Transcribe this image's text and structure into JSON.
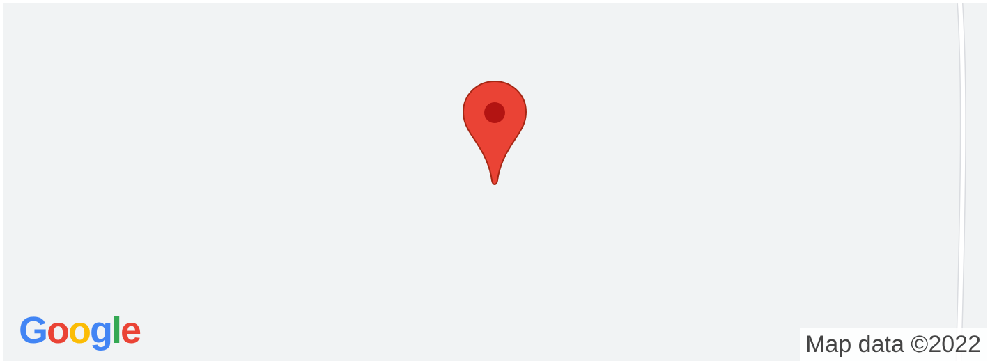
{
  "map": {
    "background_color": "#f1f3f4",
    "road_color": "#ffffff",
    "road_edge_color": "#dadce0"
  },
  "marker": {
    "icon": "map-pin-icon",
    "fill_color": "#ea4335",
    "dot_color": "#b31412"
  },
  "logo": {
    "text": "Google",
    "letters": [
      {
        "char": "G",
        "color": "#4285f4"
      },
      {
        "char": "o",
        "color": "#ea4335"
      },
      {
        "char": "o",
        "color": "#fbbc05"
      },
      {
        "char": "g",
        "color": "#4285f4"
      },
      {
        "char": "l",
        "color": "#34a853"
      },
      {
        "char": "e",
        "color": "#ea4335"
      }
    ]
  },
  "attribution": {
    "text": "Map data ©2022"
  }
}
